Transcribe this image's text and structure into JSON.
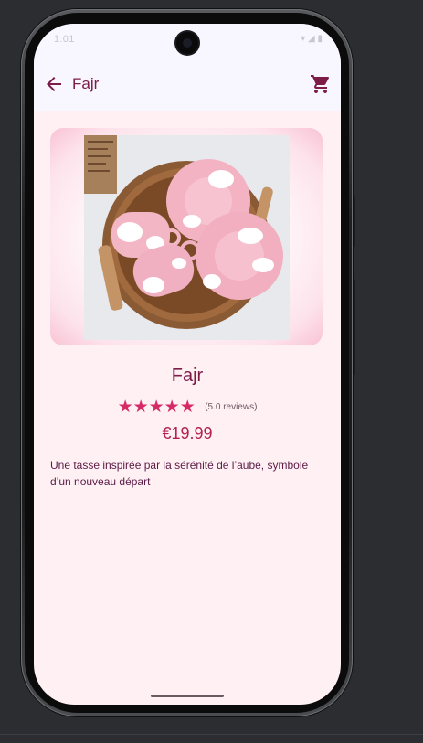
{
  "status_bar": {
    "time": "1:01",
    "icons": "▾ ◢ ▮"
  },
  "app_bar": {
    "title": "Fajr",
    "back_icon": "arrow-back-icon",
    "cart_icon": "shopping-cart-icon"
  },
  "product": {
    "name": "Fajr",
    "rating_stars": "★★★★★",
    "rating_value": 5.0,
    "reviews_label": "(5.0 reviews)",
    "price": "€19.99",
    "description": "Une tasse inspirée par la sérénité de l’aube, symbole d’un nouveau départ"
  },
  "colors": {
    "accent": "#7d1c48",
    "star": "#d42a66",
    "price": "#b3204f",
    "background": "#fff0f3",
    "bar": "#f8f6ff"
  }
}
